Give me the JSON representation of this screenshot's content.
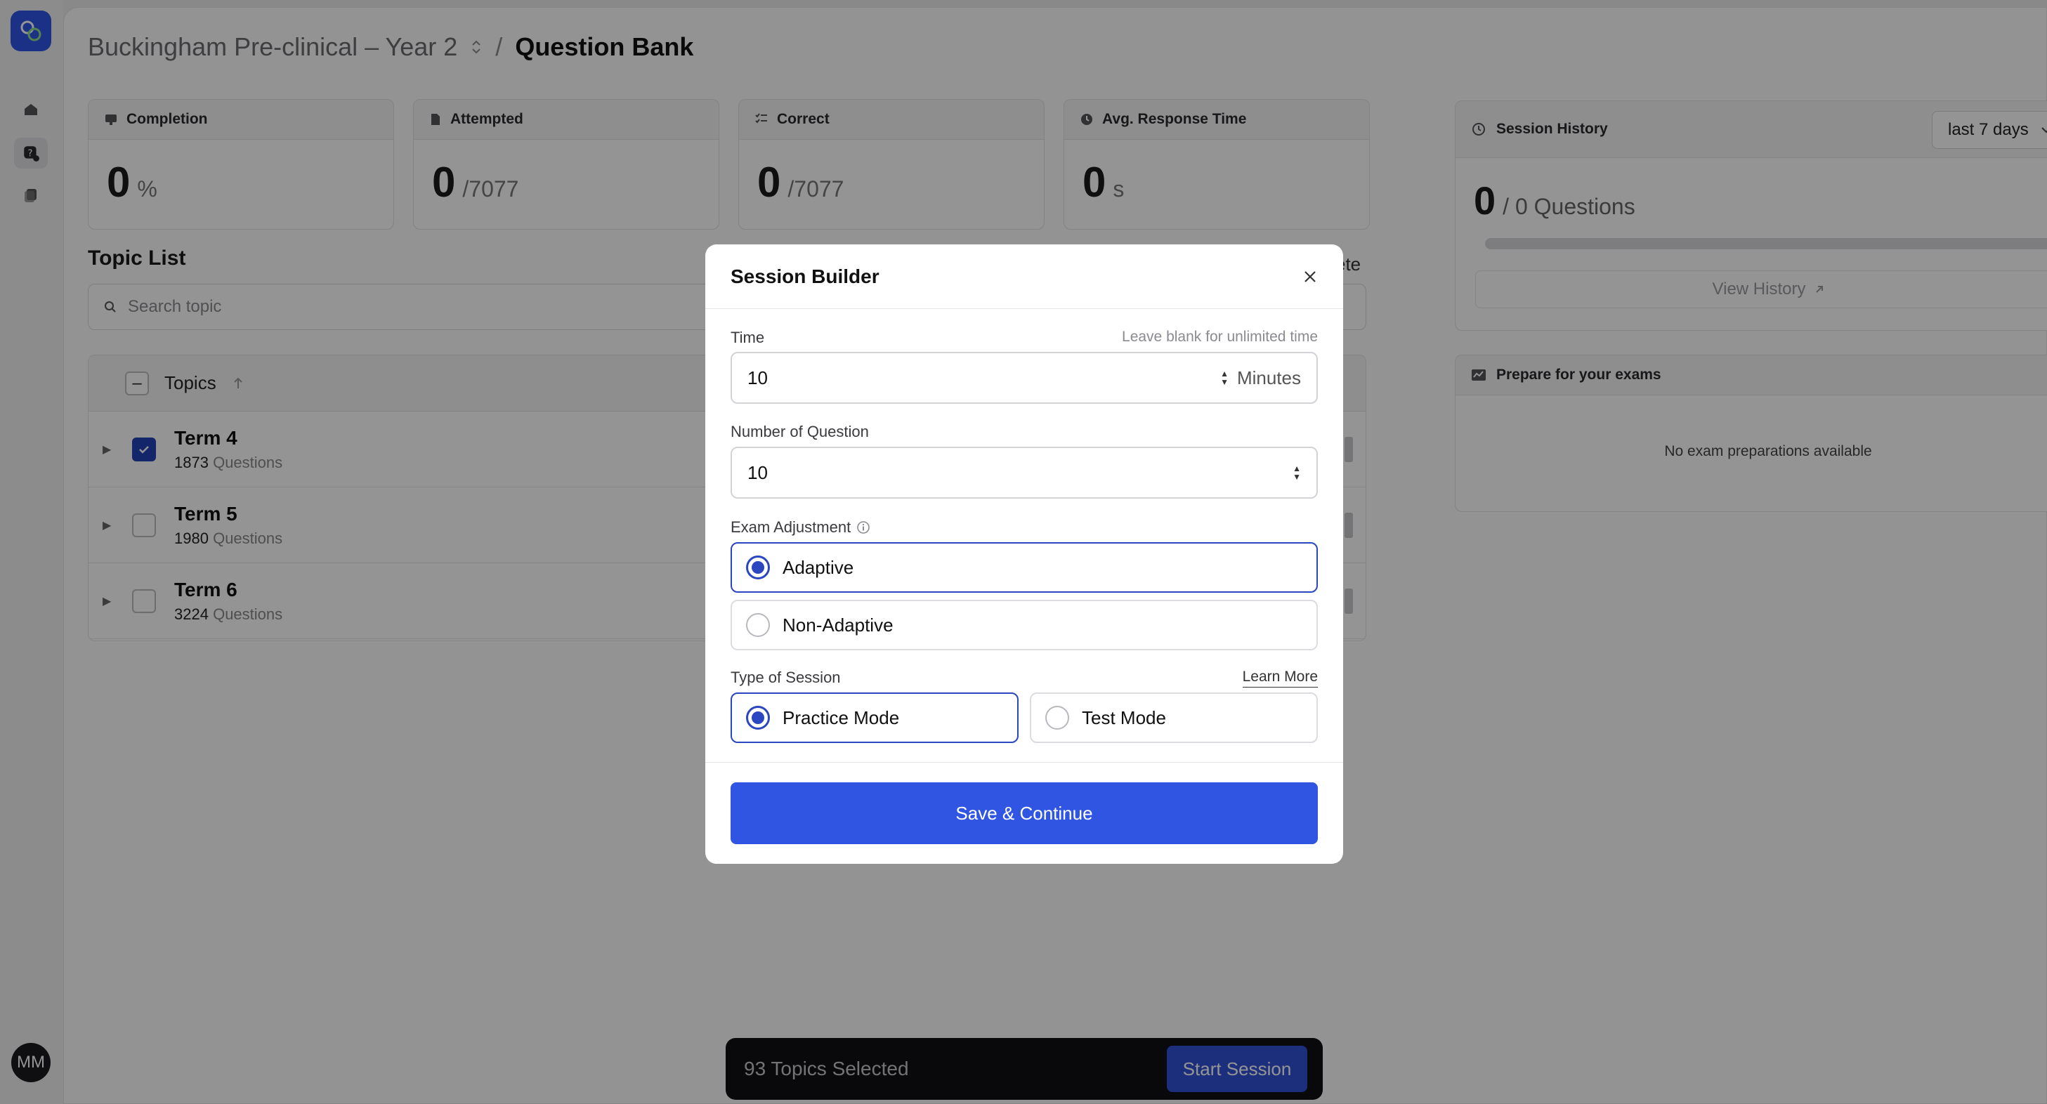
{
  "rail": {
    "avatar_initials": "MM"
  },
  "breadcrumb": {
    "workspace": "Buckingham Pre-clinical – Year 2",
    "separator": "/",
    "page": "Question Bank"
  },
  "stats": [
    {
      "label": "Completion",
      "value": "0",
      "unit": "%",
      "icon": "chart-icon"
    },
    {
      "label": "Attempted",
      "value": "0",
      "unit": "/7077",
      "icon": "document-icon"
    },
    {
      "label": "Correct",
      "value": "0",
      "unit": "/7077",
      "icon": "checklist-icon"
    },
    {
      "label": "Avg. Response Time",
      "value": "0",
      "unit": "s",
      "icon": "clock-icon"
    }
  ],
  "topic_list": {
    "title": "Topic List",
    "search_placeholder": "Search topic",
    "delete_partial": "ete",
    "column_header": "Topics",
    "rows": [
      {
        "name": "Term 4",
        "count": "1873",
        "count_label": "Questions",
        "checked": true
      },
      {
        "name": "Term 5",
        "count": "1980",
        "count_label": "Questions",
        "checked": false
      },
      {
        "name": "Term 6",
        "count": "3224",
        "count_label": "Questions",
        "checked": false
      }
    ]
  },
  "session_history": {
    "title": "Session History",
    "range": "last 7 days",
    "count": "0",
    "of_text": "/ 0 Questions",
    "progress": 0,
    "view_history": "View History"
  },
  "exam_prep": {
    "title": "Prepare for your exams",
    "empty": "No exam preparations available"
  },
  "bottom_bar": {
    "selected": "93 Topics Selected",
    "start": "Start Session"
  },
  "modal": {
    "title": "Session Builder",
    "time": {
      "label": "Time",
      "hint": "Leave blank for unlimited time",
      "value": "10",
      "unit": "Minutes"
    },
    "questions": {
      "label": "Number of Question",
      "value": "10"
    },
    "exam_adjustment": {
      "label": "Exam Adjustment",
      "options": [
        {
          "label": "Adaptive",
          "selected": true
        },
        {
          "label": "Non-Adaptive",
          "selected": false
        }
      ]
    },
    "session_type": {
      "label": "Type of Session",
      "learn_more": "Learn More",
      "options": [
        {
          "label": "Practice Mode",
          "selected": true
        },
        {
          "label": "Test Mode",
          "selected": false
        }
      ]
    },
    "save": "Save & Continue"
  },
  "colors": {
    "accent": "#2f55e2",
    "selected_border": "#2a46c0",
    "checkbox": "#2442b7"
  }
}
